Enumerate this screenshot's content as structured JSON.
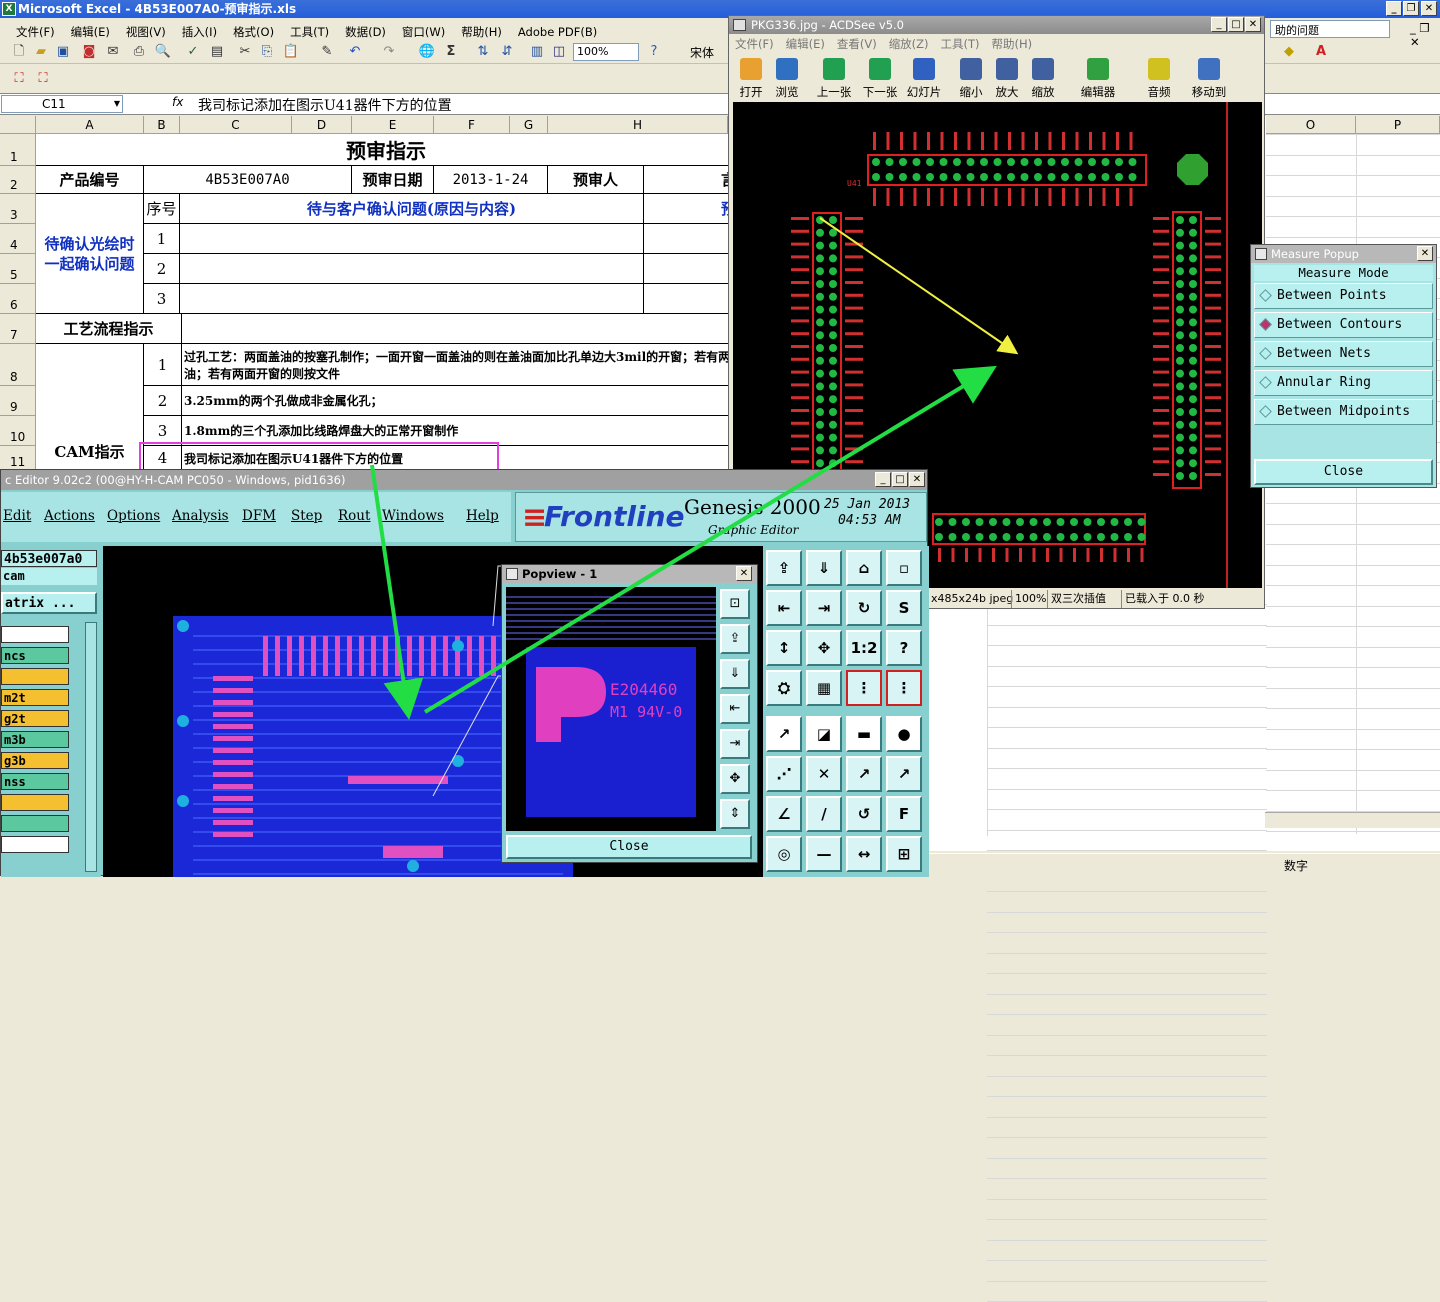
{
  "excel": {
    "title": "Microsoft Excel - 4B53E007A0-预审指示.xls",
    "menu": [
      "文件(F)",
      "编辑(E)",
      "视图(V)",
      "插入(I)",
      "格式(O)",
      "工具(T)",
      "数据(D)",
      "窗口(W)",
      "帮助(H)",
      "Adobe PDF(B)"
    ],
    "help_box": "助的问题",
    "zoom": "100%",
    "font": "宋体",
    "name_box": "C11",
    "fx": "fx",
    "formula": "我司标记添加在图示U41器件下方的位置",
    "columns": [
      "A",
      "B",
      "C",
      "D",
      "E",
      "F",
      "G",
      "H",
      "O",
      "P"
    ],
    "rows": [
      "1",
      "2",
      "3",
      "4",
      "5",
      "6",
      "7",
      "8",
      "9",
      "10",
      "11"
    ],
    "sheet": {
      "title": "预审指示",
      "product_label": "产品编号",
      "product_value": "4B53E007A0",
      "date_label": "预审日期",
      "date_value": "2013-1-24",
      "person_label": "预审人",
      "cut_r2": "言",
      "seq_label": "序号",
      "confirm_header": "待与客户确认问题(原因与内容)",
      "cut_r3": "预",
      "left_note": "待确认光绘时一起确认问题",
      "seq": [
        "1",
        "2",
        "3"
      ],
      "process_label": "工艺流程指示",
      "cam_label": "CAM指示",
      "cam_items": [
        {
          "n": "1",
          "text": "过孔工艺：两面盖油的按塞孔制作；一面开窗一面盖油的则在盖油面加比孔单边大3mil的开窗；若有两面开窗的则按文件",
          "text2": "油；若有两面开窗的则按文件"
        },
        {
          "n": "2",
          "text": "3.25mm的两个孔做成非金属化孔；"
        },
        {
          "n": "3",
          "text": "1.8mm的三个孔添加比线路焊盘大的正常开窗制作"
        },
        {
          "n": "4",
          "text": "我司标记添加在图示U41器件下方的位置"
        }
      ]
    },
    "status": "数字"
  },
  "acdsee": {
    "title": "PKG336.jpg - ACDSee v5.0",
    "menu": [
      "文件(F)",
      "编辑(E)",
      "查看(V)",
      "缩放(Z)",
      "工具(T)",
      "帮助(H)"
    ],
    "buttons": [
      "打开",
      "浏览",
      "上一张",
      "下一张",
      "幻灯片",
      "缩小",
      "放大",
      "缩放",
      "编辑器",
      "音频",
      "移动到"
    ],
    "chip_label": "U41",
    "status": [
      "x485x24b jpeg",
      "100%",
      "双三次插值",
      "已载入于 0.0 秒"
    ]
  },
  "measure": {
    "title": "Measure Popup",
    "header": "Measure Mode",
    "items": [
      "Between Points",
      "Between Contours",
      "Between Nets",
      "Annular Ring",
      "Between Midpoints"
    ],
    "selected": 1,
    "close": "Close"
  },
  "genesis": {
    "title": "c Editor 9.02c2 (00@HY-H-CAM PC050 - Windows, pid1636)",
    "menu": [
      "Edit",
      "Actions",
      "Options",
      "Analysis",
      "DFM",
      "Step",
      "Rout",
      "Windows",
      "Help"
    ],
    "logo": "Frontline",
    "product": "Genesis 2000",
    "subtitle": "Graphic Editor",
    "date": "25 Jan 2013",
    "time": "04:53 AM",
    "job": "4b53e007a0",
    "step": "cam",
    "matrix": "atrix ...",
    "layers": [
      "",
      "ncs",
      "",
      "m2t",
      "g2t",
      "m3b",
      "g3b",
      "nss",
      "",
      "",
      ""
    ],
    "layer_colors": [
      "#ffffff",
      "#5bc8a0",
      "#f5c030",
      "#f5c030",
      "#f5c030",
      "#5bc8a0",
      "#f5c030",
      "#5bc8a0",
      "#f5c030",
      "#5bc8a0",
      "#ffffff"
    ],
    "tool_labels": [
      "1:2",
      "?"
    ]
  },
  "popview": {
    "title": "Popview - 1",
    "marking1": "E204460",
    "marking2": "M1 94V-0",
    "close": "Close"
  },
  "colors": {
    "arrow_green": "#22dd44",
    "arrow_yellow": "#f0f040",
    "highlight": "#e040e0",
    "pcb_blue": "#2040ff"
  }
}
